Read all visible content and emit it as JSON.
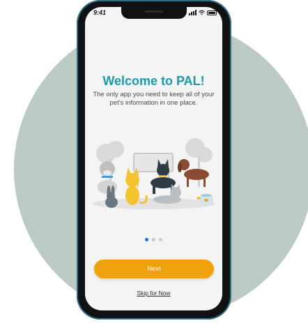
{
  "status_bar": {
    "time": "9:41"
  },
  "onboarding": {
    "title": "Welcome to PAL!",
    "subtitle_line1": "The only app you need to keep all of your",
    "subtitle_line2": "pet's information in one place.",
    "page_indicator": {
      "total": 3,
      "active": 1
    },
    "next_label": "Next",
    "skip_label": "Skip for Now"
  },
  "colors": {
    "title": "#1b9aaa",
    "next_button": "#f0a20e",
    "active_dot": "#1a73d6",
    "background_circle": "#bccac4"
  }
}
